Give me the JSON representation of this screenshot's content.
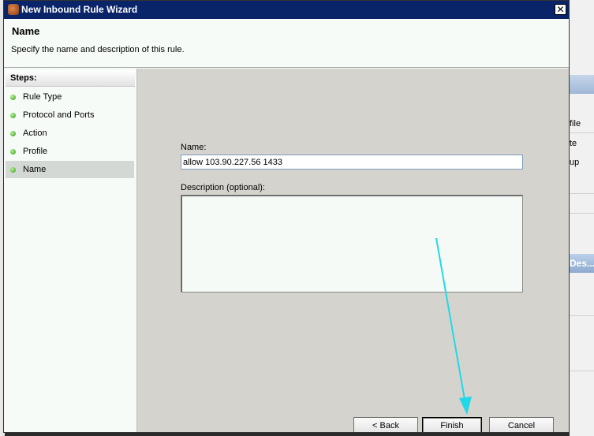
{
  "window": {
    "title": "New Inbound Rule Wizard",
    "close_glyph": "✕"
  },
  "header": {
    "title": "Name",
    "subtitle": "Specify the name and description of this rule."
  },
  "steps": {
    "heading": "Steps:",
    "items": [
      {
        "label": "Rule Type"
      },
      {
        "label": "Protocol and Ports"
      },
      {
        "label": "Action"
      },
      {
        "label": "Profile"
      },
      {
        "label": "Name"
      }
    ],
    "active_index": 4
  },
  "form": {
    "name_label": "Name:",
    "name_value": "allow 103.90.227.56 1433",
    "description_label": "Description (optional):",
    "description_value": ""
  },
  "buttons": {
    "back": "< Back",
    "finish": "Finish",
    "cancel": "Cancel"
  },
  "background_app": {
    "items": [
      "file",
      "te",
      "up"
    ],
    "header_text": "Des..."
  },
  "colors": {
    "titlebar": "#0a246a",
    "content_bg": "#d4d3cd",
    "annotation_arrow": "#22d8e8"
  }
}
